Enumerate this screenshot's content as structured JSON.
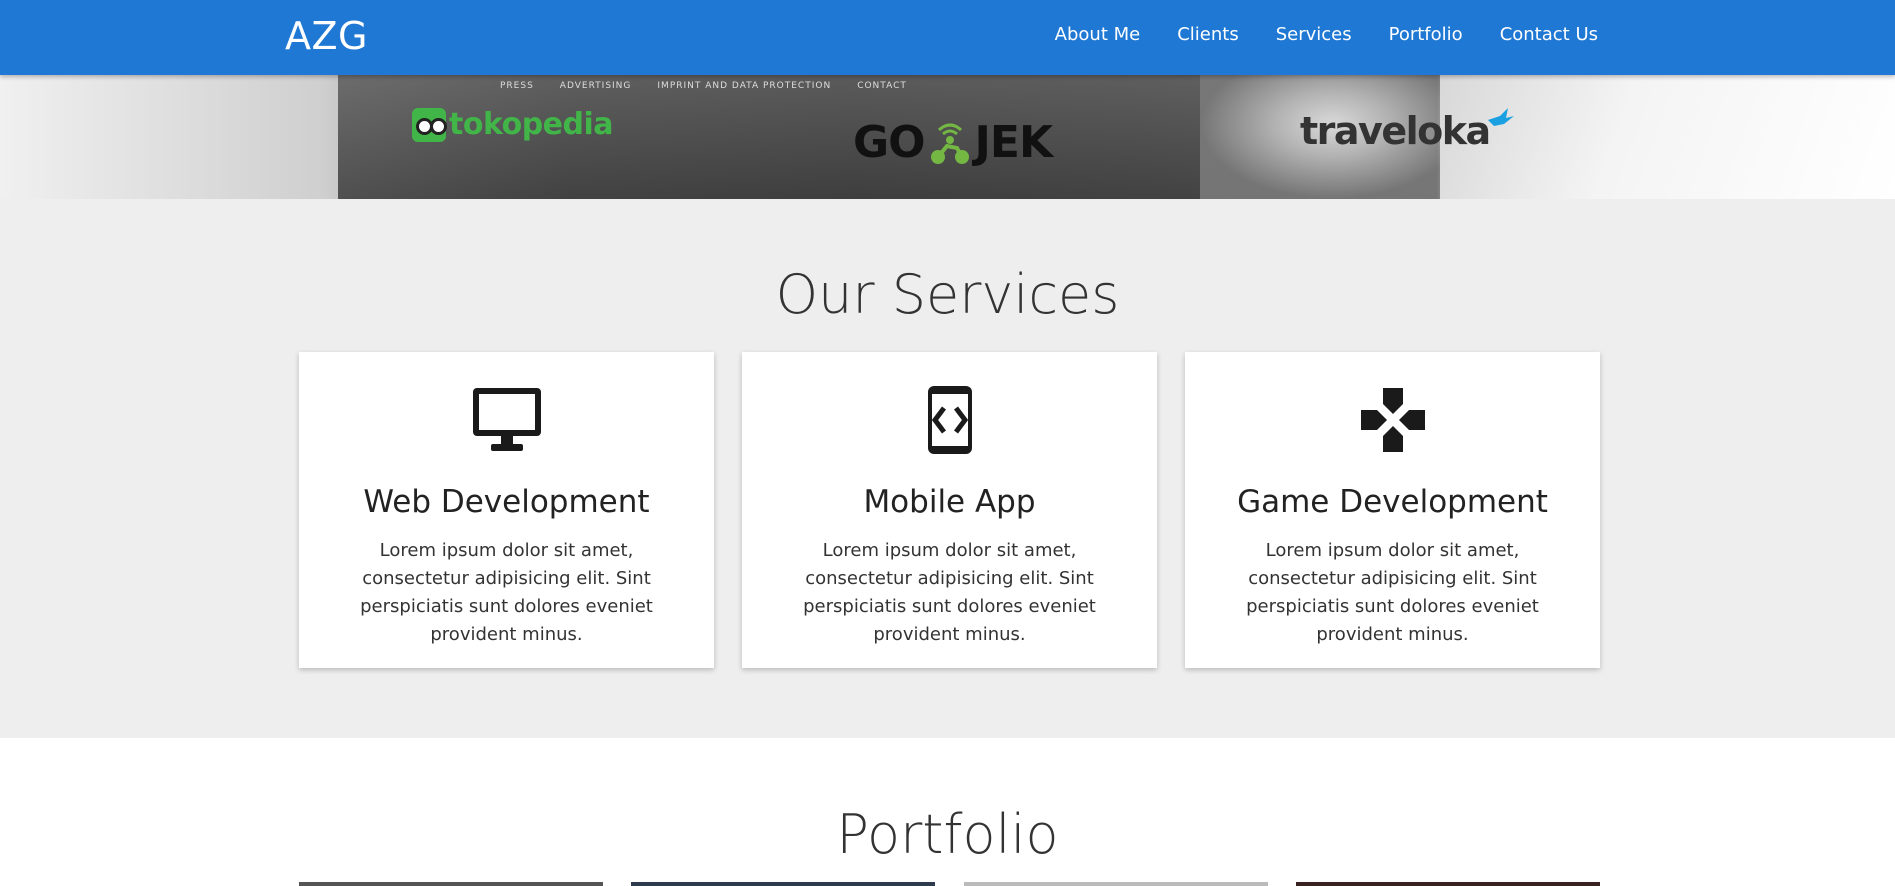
{
  "navbar": {
    "brand": "AZG",
    "links": [
      "About Me",
      "Clients",
      "Services",
      "Portfolio",
      "Contact Us"
    ],
    "bg_color": "#1e78d4"
  },
  "clients": {
    "background_menu": [
      "PRESS",
      "ADVERTISING",
      "IMPRINT AND DATA PROTECTION",
      "CONTACT"
    ],
    "logos": [
      "tokopedia",
      "GO-JEK",
      "traveloka"
    ],
    "gojek_left": "GO",
    "gojek_right": "JEK"
  },
  "services": {
    "title": "Our Services",
    "cards": [
      {
        "title": "Web Development",
        "icon": "monitor-icon",
        "text": "Lorem ipsum dolor sit amet, consectetur adipisicing elit. Sint perspiciatis sunt dolores eveniet provident minus."
      },
      {
        "title": "Mobile App",
        "icon": "mobile-code-icon",
        "text": "Lorem ipsum dolor sit amet, consectetur adipisicing elit. Sint perspiciatis sunt dolores eveniet provident minus."
      },
      {
        "title": "Game Development",
        "icon": "gamepad-icon",
        "text": "Lorem ipsum dolor sit amet, consectetur adipisicing elit. Sint perspiciatis sunt dolores eveniet provident minus."
      }
    ]
  },
  "portfolio": {
    "title": "Portfolio"
  }
}
